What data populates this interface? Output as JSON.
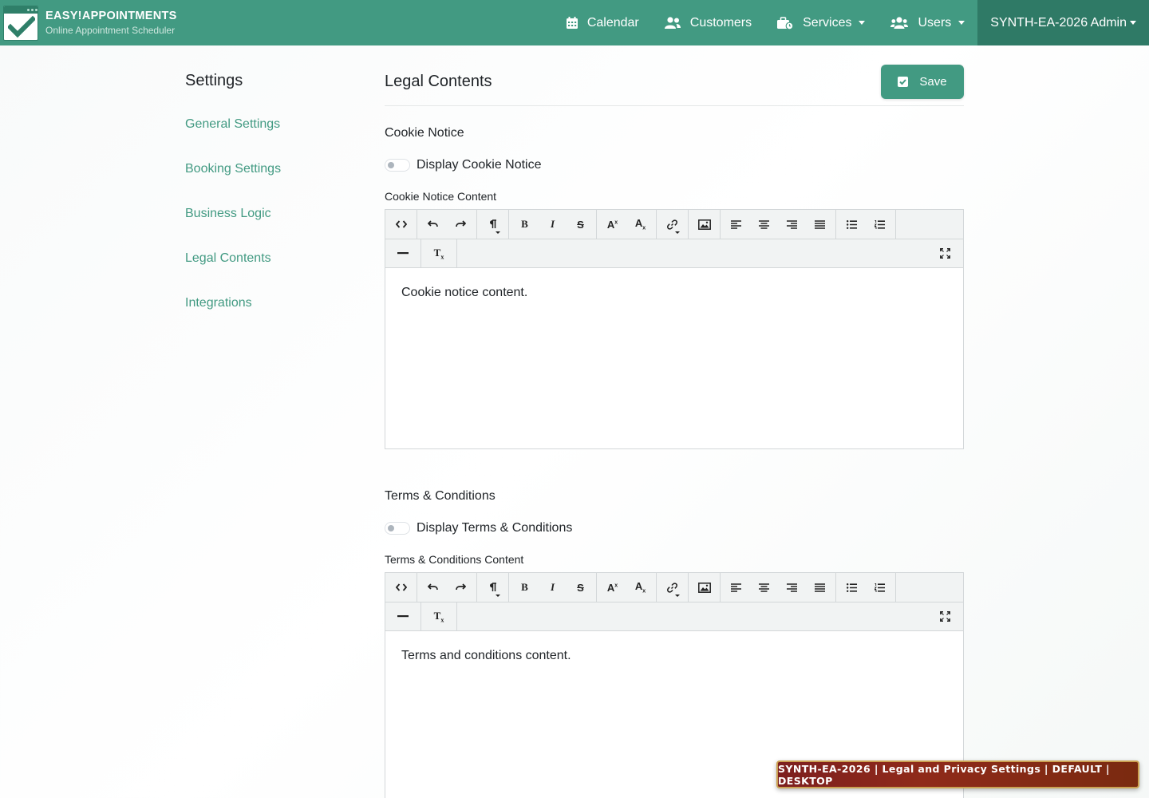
{
  "brand": {
    "title": "EASY!APPOINTMENTS",
    "subtitle": "Online Appointment Scheduler"
  },
  "nav": {
    "calendar": "Calendar",
    "customers": "Customers",
    "services": "Services",
    "users": "Users",
    "admin": "SYNTH-EA-2026 Admin"
  },
  "sidebar": {
    "title": "Settings",
    "items": [
      {
        "label": "General Settings"
      },
      {
        "label": "Booking Settings"
      },
      {
        "label": "Business Logic"
      },
      {
        "label": "Legal Contents"
      },
      {
        "label": "Integrations"
      }
    ]
  },
  "main": {
    "title": "Legal Contents",
    "save_label": "Save",
    "cookie": {
      "section_title": "Cookie Notice",
      "toggle_label": "Display Cookie Notice",
      "toggle_on": false,
      "content_label": "Cookie Notice Content",
      "content": "Cookie notice content."
    },
    "terms": {
      "section_title": "Terms & Conditions",
      "toggle_label": "Display Terms & Conditions",
      "toggle_on": false,
      "content_label": "Terms & Conditions Content",
      "content": "Terms and conditions content."
    }
  },
  "badge": "SYNTH-EA-2026 | Legal and Privacy Settings | DEFAULT | DESKTOP",
  "colors": {
    "primary": "#429a82",
    "nav_active": "#2f7a66",
    "badge_bg": "#8f2a1a",
    "badge_border": "#caa052"
  }
}
